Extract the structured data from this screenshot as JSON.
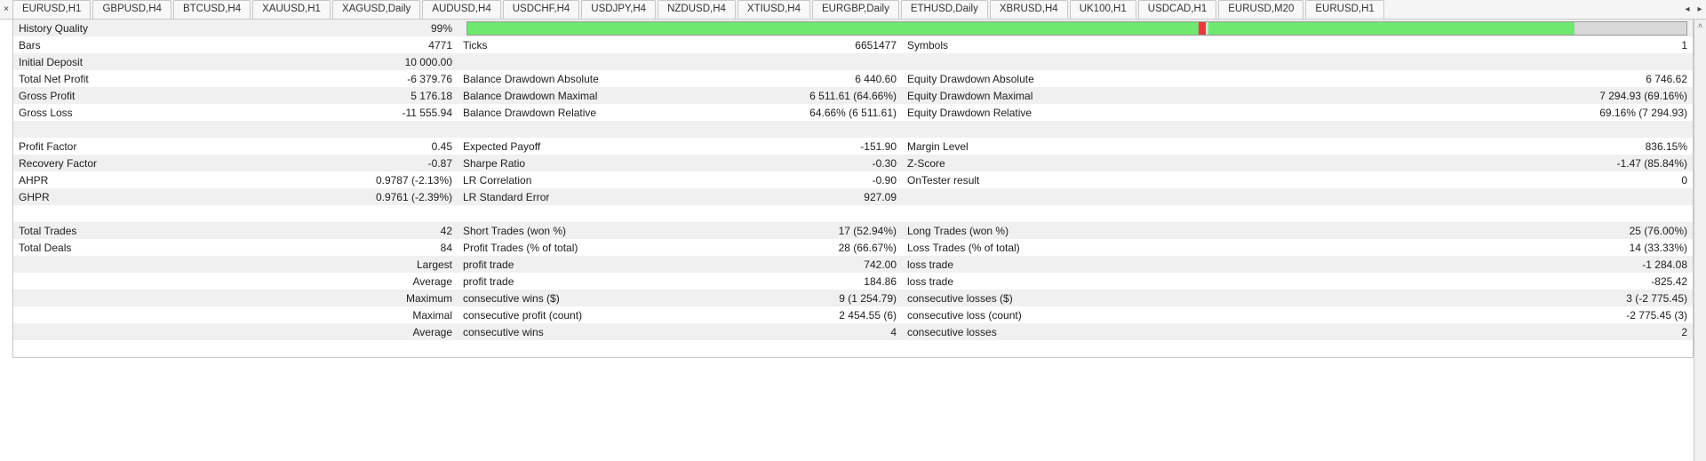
{
  "tabs": [
    "EURUSD,H1",
    "GBPUSD,H4",
    "BTCUSD,H4",
    "XAUUSD,H1",
    "XAGUSD,Daily",
    "AUDUSD,H4",
    "USDCHF,H4",
    "USDJPY,H4",
    "NZDUSD,H4",
    "XTIUSD,H4",
    "EURGBP,Daily",
    "ETHUSD,Daily",
    "XBRUSD,H4",
    "UK100,H1",
    "USDCAD,H1",
    "EURUSD,M20",
    "EURUSD,H1"
  ],
  "history_quality": {
    "label": "History Quality",
    "value": "99%",
    "green1_pct": 60,
    "red_pct": 60,
    "green2_pct": 30,
    "gray_pct": 10
  },
  "rows": [
    {
      "l1": "Bars",
      "v1": "4771",
      "l2": "Ticks",
      "v2": "6651477",
      "l3": "Symbols",
      "v3": "1"
    },
    {
      "l1": "Initial Deposit",
      "v1": "10 000.00",
      "l2": "",
      "v2": "",
      "l3": "",
      "v3": ""
    },
    {
      "l1": "Total Net Profit",
      "v1": "-6 379.76",
      "l2": "Balance Drawdown Absolute",
      "v2": "6 440.60",
      "l3": "Equity Drawdown Absolute",
      "v3": "6 746.62"
    },
    {
      "l1": "Gross Profit",
      "v1": "5 176.18",
      "l2": "Balance Drawdown Maximal",
      "v2": "6 511.61 (64.66%)",
      "l3": "Equity Drawdown Maximal",
      "v3": "7 294.93 (69.16%)"
    },
    {
      "l1": "Gross Loss",
      "v1": "-11 555.94",
      "l2": "Balance Drawdown Relative",
      "v2": "64.66% (6 511.61)",
      "l3": "Equity Drawdown Relative",
      "v3": "69.16% (7 294.93)"
    },
    {
      "l1": "",
      "v1": "",
      "l2": "",
      "v2": "",
      "l3": "",
      "v3": ""
    },
    {
      "l1": "Profit Factor",
      "v1": "0.45",
      "l2": "Expected Payoff",
      "v2": "-151.90",
      "l3": "Margin Level",
      "v3": "836.15%"
    },
    {
      "l1": "Recovery Factor",
      "v1": "-0.87",
      "l2": "Sharpe Ratio",
      "v2": "-0.30",
      "l3": "Z-Score",
      "v3": "-1.47 (85.84%)"
    },
    {
      "l1": "AHPR",
      "v1": "0.9787 (-2.13%)",
      "l2": "LR Correlation",
      "v2": "-0.90",
      "l3": "OnTester result",
      "v3": "0"
    },
    {
      "l1": "GHPR",
      "v1": "0.9761 (-2.39%)",
      "l2": "LR Standard Error",
      "v2": "927.09",
      "l3": "",
      "v3": ""
    },
    {
      "l1": "",
      "v1": "",
      "l2": "",
      "v2": "",
      "l3": "",
      "v3": ""
    },
    {
      "l1": "Total Trades",
      "v1": "42",
      "l2": "Short Trades (won %)",
      "v2": "17 (52.94%)",
      "l3": "Long Trades (won %)",
      "v3": "25 (76.00%)"
    },
    {
      "l1": "Total Deals",
      "v1": "84",
      "l2": "Profit Trades (% of total)",
      "v2": "28 (66.67%)",
      "l3": "Loss Trades (% of total)",
      "v3": "14 (33.33%)"
    },
    {
      "l1": "",
      "v1": "Largest",
      "l2": "profit trade",
      "v2": "742.00",
      "l3": "loss trade",
      "v3": "-1 284.08"
    },
    {
      "l1": "",
      "v1": "Average",
      "l2": "profit trade",
      "v2": "184.86",
      "l3": "loss trade",
      "v3": "-825.42"
    },
    {
      "l1": "",
      "v1": "Maximum",
      "l2": "consecutive wins ($)",
      "v2": "9 (1 254.79)",
      "l3": "consecutive losses ($)",
      "v3": "3 (-2 775.45)"
    },
    {
      "l1": "",
      "v1": "Maximal",
      "l2": "consecutive profit (count)",
      "v2": "2 454.55 (6)",
      "l3": "consecutive loss (count)",
      "v3": "-2 775.45 (3)"
    },
    {
      "l1": "",
      "v1": "Average",
      "l2": "consecutive wins",
      "v2": "4",
      "l3": "consecutive losses",
      "v3": "2"
    },
    {
      "l1": "",
      "v1": "",
      "l2": "",
      "v2": "",
      "l3": "",
      "v3": ""
    }
  ]
}
